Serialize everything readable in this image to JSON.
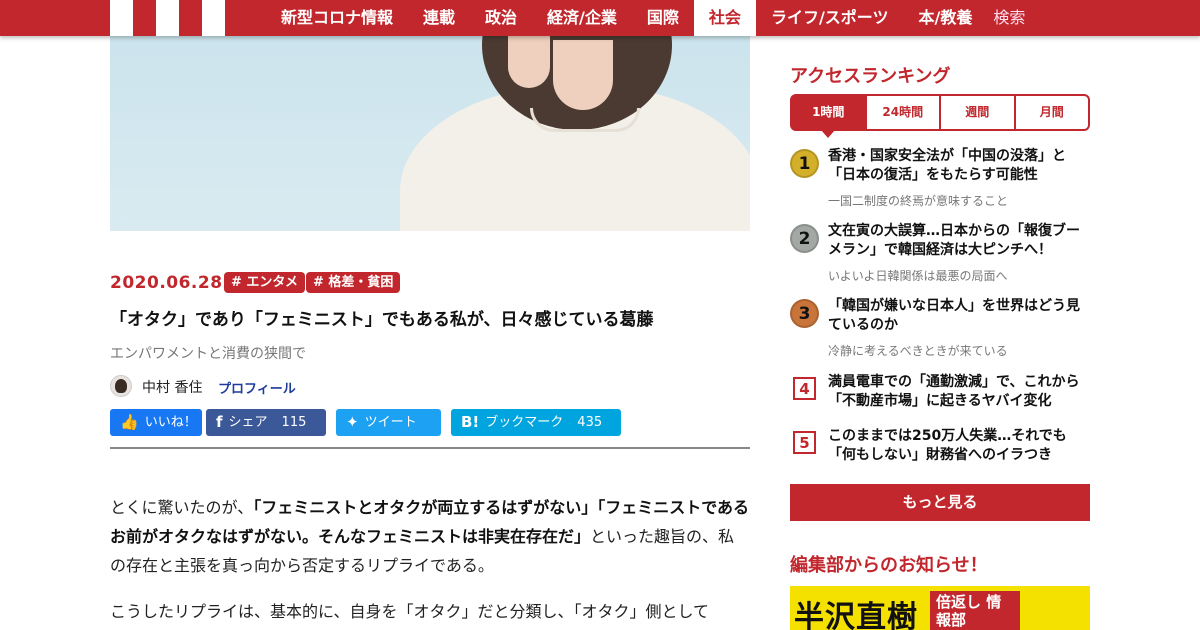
{
  "nav": {
    "items": [
      "新型コロナ情報",
      "連載",
      "政治",
      "経済/企業",
      "国際",
      "社会",
      "ライフ/スポーツ",
      "本/教養"
    ],
    "active": "社会",
    "search_label": "検索"
  },
  "article": {
    "date": "2020.06.28",
    "tags": [
      "# エンタメ",
      "# 格差・貧困"
    ],
    "title": "「オタク」であり「フェミニスト」でもある私が、日々感じている葛藤",
    "subtitle": "エンパワメントと消費の狭間で",
    "author": "中村 香住",
    "profile_link": "プロフィール",
    "share": {
      "like": "いいね！",
      "facebook": "シェア",
      "facebook_count": "115",
      "twitter": "ツイート",
      "hatena": "ブックマーク",
      "hatena_count": "435"
    },
    "body": {
      "p1_lead": "とくに驚いたのが、",
      "p1_bold": "「フェミニストとオタクが両立するはずがない」「フェミニストであるお前がオタクなはずがない。そんなフェミニストは非実在存在だ」",
      "p1_tail": "といった趣旨の、私の存在と主張を真っ向から否定するリプライである。",
      "p2": "こうしたリプライは、基本的に、自身を「オタク」だと分類し、「オタク」側として"
    }
  },
  "sidebar": {
    "ranking_title": "アクセスランキング",
    "tabs": [
      "1時間",
      "24時間",
      "週間",
      "月間"
    ],
    "active_tab": "1時間",
    "items": [
      {
        "rank": "1",
        "title": "香港・国家安全法が「中国の没落」と「日本の復活」をもたらす可能性",
        "sub": "一国二制度の終焉が意味すること",
        "color": "#d4b02a"
      },
      {
        "rank": "2",
        "title": "文在寅の大誤算…日本からの「報復ブーメラン」で韓国経済は大ピンチへ！",
        "sub": "いよいよ日韓関係は最悪の局面へ",
        "color": "#a3a8a4"
      },
      {
        "rank": "3",
        "title": "「韓国が嫌いな日本人」を世界はどう見ているのか",
        "sub": "冷静に考えるべきときが来ている",
        "color": "#c8743a"
      },
      {
        "rank": "4",
        "title": "満員電車での「通勤激減」で、これから「不動産市場」に起きるヤバイ変化",
        "sub": ""
      },
      {
        "rank": "5",
        "title": "このままでは250万人失業…それでも「何もしない」財務省へのイラつき",
        "sub": ""
      }
    ],
    "more_label": "もっと見る",
    "notice_title": "編集部からのお知らせ！",
    "promo_main": "半沢直樹",
    "promo_side": "倍返し 情報部"
  },
  "colors": {
    "brand": "#c1272d",
    "facebook": "#3b5998",
    "twitter": "#1da1f2",
    "hatena": "#00a4de",
    "like": "#1877f2"
  }
}
